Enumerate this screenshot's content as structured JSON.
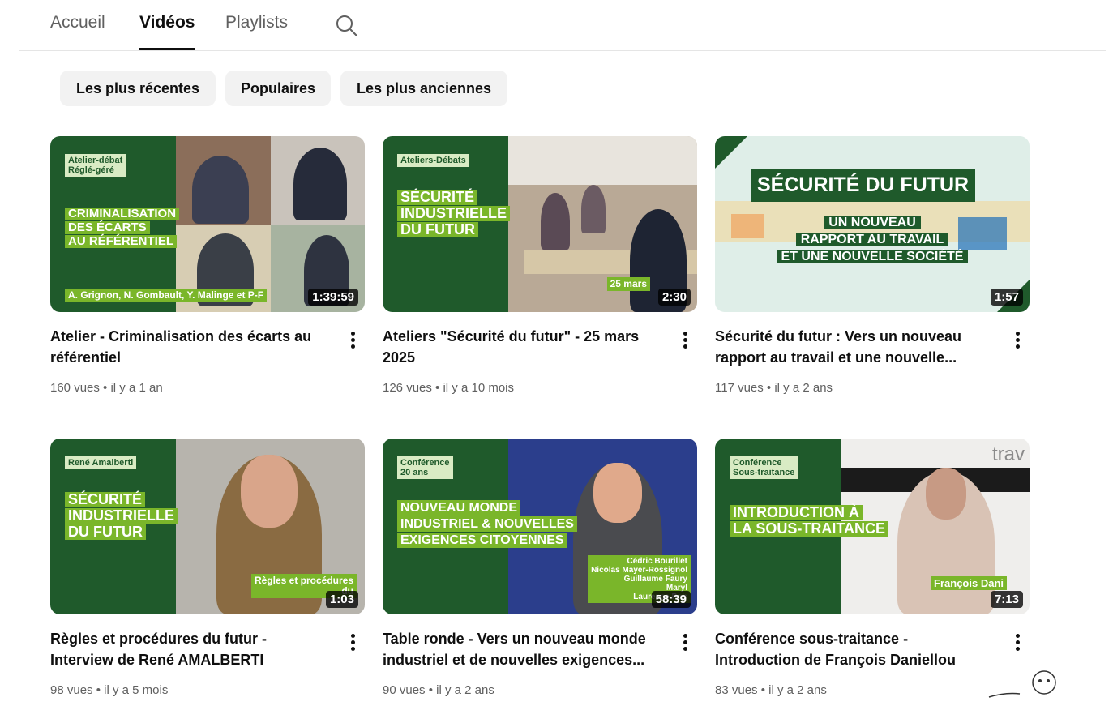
{
  "tabs": [
    {
      "label": "Accueil",
      "active": false
    },
    {
      "label": "Vidéos",
      "active": true
    },
    {
      "label": "Playlists",
      "active": false
    }
  ],
  "search_icon": "search-icon",
  "chips": [
    "Les plus récentes",
    "Populaires",
    "Les plus anciennes"
  ],
  "videos": [
    {
      "title": "Atelier - Criminalisation des écarts au référentiel",
      "meta": "160 vues • il y a 1 an",
      "duration": "1:39:59",
      "thumb": {
        "tag": "Atelier-débat\nRéglé-géré",
        "headline": [
          "CRIMINALISATION",
          "DES ÉCARTS",
          "AU RÉFÉRENTIEL"
        ],
        "caption": "A. Grignon, N. Gombault, Y. Malinge et P-F"
      }
    },
    {
      "title": "Ateliers \"Sécurité du futur\" - 25 mars 2025",
      "meta": "126 vues • il y a 10 mois",
      "duration": "2:30",
      "thumb": {
        "tag": "Ateliers-Débats",
        "headline": [
          "SÉCURITÉ",
          "INDUSTRIELLE",
          "DU FUTUR"
        ],
        "caption": "25 mars"
      }
    },
    {
      "title": "Sécurité du futur : Vers un nouveau rapport au travail et une nouvelle...",
      "meta": "117 vues • il y a 2 ans",
      "duration": "1:57",
      "thumb": {
        "banner": "SÉCURITÉ DU FUTUR",
        "lines": [
          "UN NOUVEAU",
          "RAPPORT AU TRAVAIL",
          "ET UNE NOUVELLE SOCIÉTÉ"
        ]
      }
    },
    {
      "title": "Règles et procédures du futur - Interview de René AMALBERTI",
      "meta": "98 vues • il y a 5 mois",
      "duration": "1:03",
      "thumb": {
        "tag": "René Amalberti",
        "headline": [
          "SÉCURITÉ",
          "INDUSTRIELLE",
          "DU FUTUR"
        ],
        "caption": "Règles et procédures\ndu"
      }
    },
    {
      "title": "Table ronde - Vers un nouveau monde industriel et de nouvelles exigences...",
      "meta": "90 vues • il y a 2 ans",
      "duration": "58:39",
      "thumb": {
        "tag": "Conférence\n20 ans",
        "headline": [
          "NOUVEAU MONDE",
          "INDUSTRIEL & NOUVELLES",
          "EXIGENCES CITOYENNES"
        ],
        "caption": "Cédric Bourillet\nNicolas Mayer-Rossignol\nGuillaume Faury\nMaryl\nLaurence Poir"
      }
    },
    {
      "title": "Conférence sous-traitance - Introduction de François Daniellou",
      "meta": "83 vues • il y a 2 ans",
      "duration": "7:13",
      "thumb": {
        "tag": "Conférence\nSous-traitance",
        "headline": [
          "INTRODUCTION À",
          "LA SOUS-TRAITANCE"
        ],
        "caption": "François Dani",
        "wall_text": "trav"
      }
    }
  ],
  "colors": {
    "brand_green": "#1f5a2b",
    "accent_green": "#7ab62a",
    "chip_bg": "#f2f2f2",
    "muted_text": "#606060"
  }
}
